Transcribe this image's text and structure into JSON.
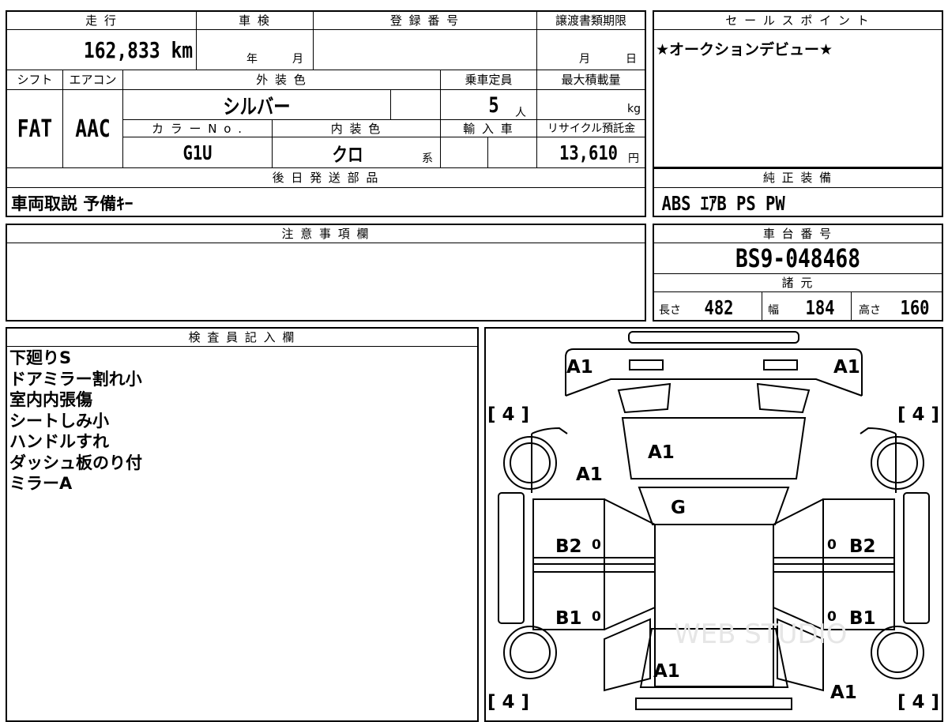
{
  "vehicle": {
    "mileage_header": "走 行",
    "mileage_value": "162,833 km",
    "inspection_header": "車 検",
    "inspection_year": "年",
    "inspection_month": "月",
    "registration_header": "登 録 番 号",
    "transfer_header": "譲渡書類期限",
    "transfer_month": "月",
    "transfer_day": "日",
    "shift_header": "シフト",
    "shift_value": "FAT",
    "aircon_header": "エアコン",
    "aircon_value": "AAC",
    "exterior_header": "外 装 色",
    "exterior_value": "シルバー",
    "capacity_header": "乗車定員",
    "capacity_value": "5",
    "capacity_unit": "人",
    "load_header": "最大積載量",
    "load_unit": "kg",
    "color_no_header": "カ ラ ー N o .",
    "color_no_value": "G1U",
    "interior_header": "内 装 色",
    "interior_value": "クロ",
    "interior_unit": "系",
    "import_header": "輸 入 車",
    "recycle_header": "リサイクル預託金",
    "recycle_value": "13,610",
    "recycle_unit": "円",
    "later_parts_header": "後 日 発 送 部 品",
    "later_parts_value": "車両取説 予備ｷｰ"
  },
  "sales": {
    "header": "セ ー ル ス ポ イ ン ト",
    "text": "★オークションデビュー★"
  },
  "equipment": {
    "header": "純 正 装 備",
    "value": "ABS ｴｱB PS PW"
  },
  "notes": {
    "header": "注 意 事 項 欄"
  },
  "chassis": {
    "header": "車 台 番 号",
    "value": "BS9-048468"
  },
  "specs": {
    "header": "諸 元",
    "length_label": "長さ",
    "length_value": "482",
    "width_label": "幅",
    "width_value": "184",
    "height_label": "高さ",
    "height_value": "160"
  },
  "inspector": {
    "header": "検 査 員 記 入 欄",
    "lines": [
      "下廻りS",
      "ドアミラー割れ小",
      "室内内張傷",
      "シートしみ小",
      "ハンドルすれ",
      "ダッシュ板のり付",
      "ミラーA"
    ]
  },
  "diagram": {
    "watermark": "WEB STUDIO",
    "marks": {
      "top_left": "A1",
      "top_right": "A1",
      "tire_fl": "[ 4 ]",
      "tire_fr": "[ 4 ]",
      "tire_rl": "[ 4 ]",
      "tire_rr": "[ 4 ]",
      "hood": "A1",
      "fender_left": "A1",
      "windshield": "G",
      "front_door_left": "B2",
      "front_door_right": "B2",
      "rear_door_left": "B1",
      "rear_door_right": "B1",
      "zero_1": "0",
      "zero_2": "0",
      "zero_3": "0",
      "zero_4": "0",
      "rear_center": "A1",
      "rear_right": "A1"
    }
  }
}
